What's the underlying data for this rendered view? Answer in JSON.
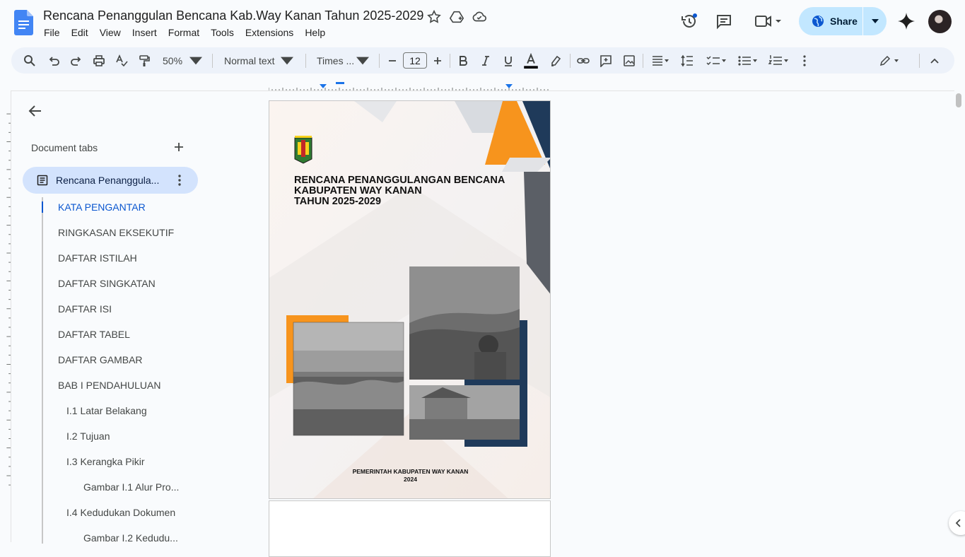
{
  "header": {
    "title": "Rencana Penanggulan Bencana Kab.Way Kanan Tahun 2025-2029",
    "menu": [
      "File",
      "Edit",
      "View",
      "Insert",
      "Format",
      "Tools",
      "Extensions",
      "Help"
    ],
    "share_label": "Share"
  },
  "toolbar": {
    "zoom": "50%",
    "style": "Normal text",
    "font": "Times ...",
    "font_size": "12"
  },
  "sidebar": {
    "tabs_label": "Document tabs",
    "active_tab_label": "Rencana Penanggula...",
    "outline": [
      {
        "label": "KATA PENGANTAR",
        "level": 1,
        "active": true
      },
      {
        "label": "RINGKASAN EKSEKUTIF",
        "level": 1
      },
      {
        "label": "DAFTAR ISTILAH",
        "level": 1
      },
      {
        "label": "DAFTAR SINGKATAN",
        "level": 1
      },
      {
        "label": "DAFTAR ISI",
        "level": 1
      },
      {
        "label": "DAFTAR TABEL",
        "level": 1
      },
      {
        "label": "DAFTAR GAMBAR",
        "level": 1
      },
      {
        "label": "BAB I PENDAHULUAN",
        "level": 1
      },
      {
        "label": "I.1 Latar Belakang",
        "level": 2
      },
      {
        "label": "I.2 Tujuan",
        "level": 2
      },
      {
        "label": "I.3 Kerangka Pikir",
        "level": 2
      },
      {
        "label": "Gambar I.1 Alur Pro...",
        "level": 3
      },
      {
        "label": "I.4 Kedudukan Dokumen",
        "level": 2
      },
      {
        "label": "Gambar I.2 Kedudu...",
        "level": 3
      }
    ]
  },
  "cover": {
    "title_lines": [
      "RENCANA PENANGGULANGAN BENCANA",
      "KABUPATEN WAY KANAN",
      "TAHUN 2025-2029"
    ],
    "footer_line1": "PEMERINTAH KABUPATEN WAY KANAN",
    "footer_line2": "2024"
  },
  "colors": {
    "accent_blue": "#0b57d0",
    "share_bg": "#c2e7ff",
    "cover_orange": "#f7941d",
    "cover_navy": "#1f3a5a"
  }
}
